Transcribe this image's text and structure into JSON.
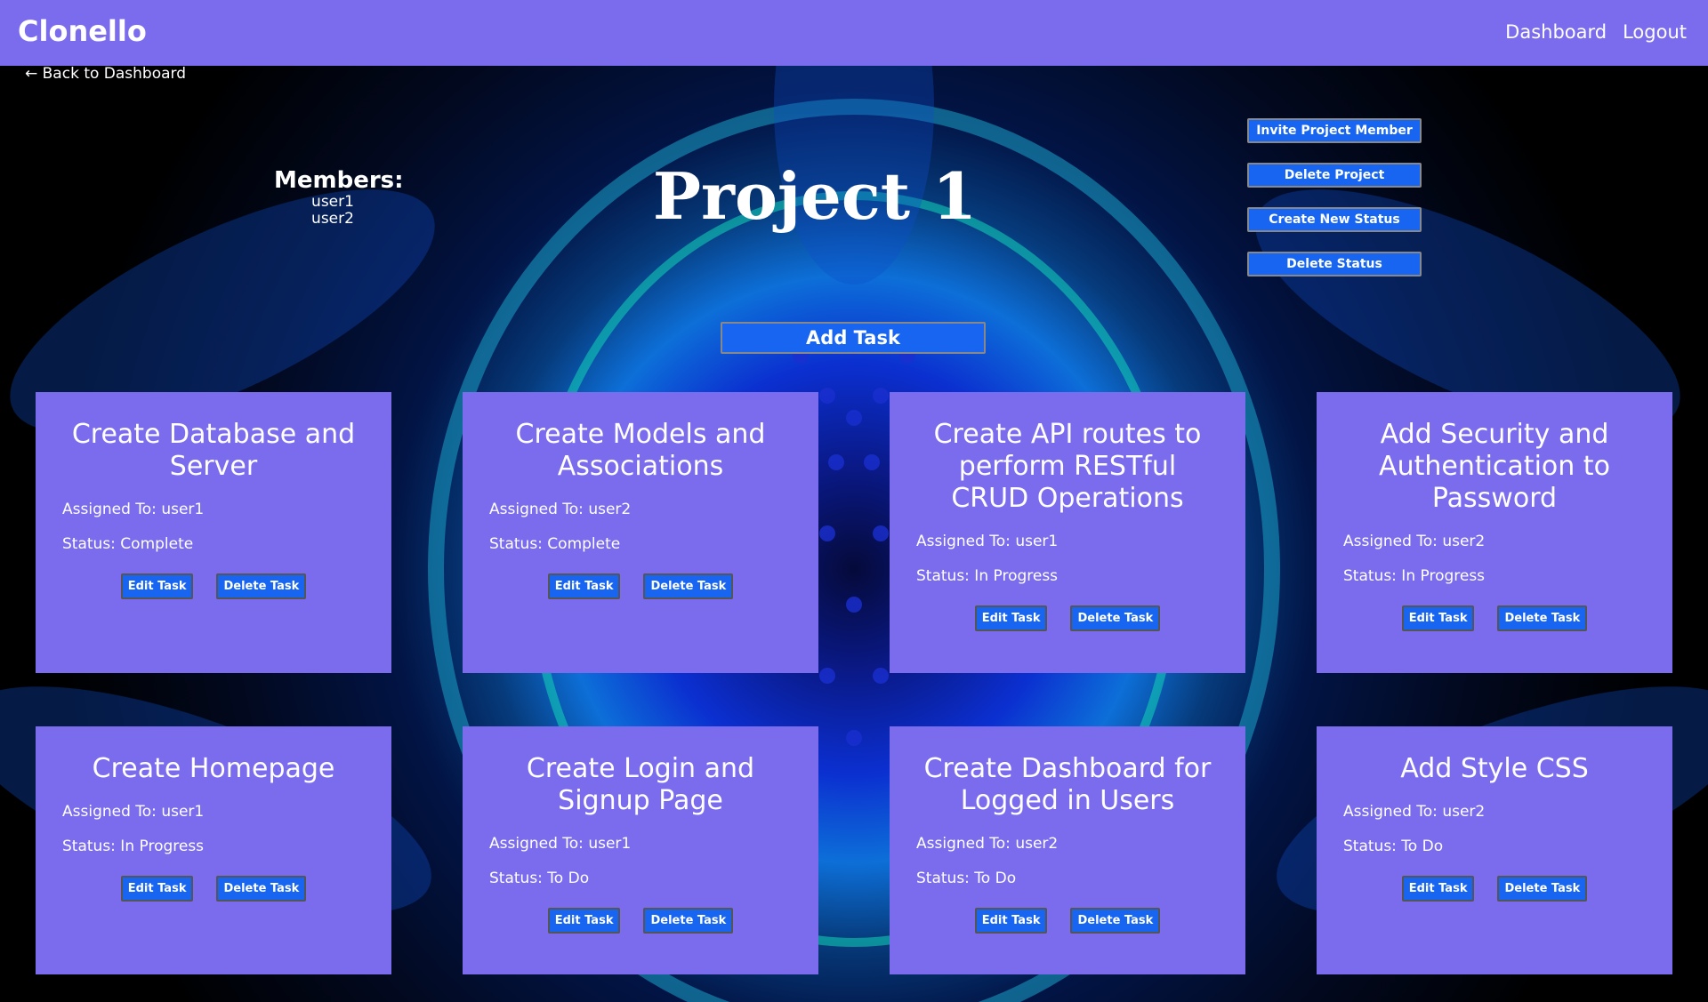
{
  "navbar": {
    "brand": "Clonello",
    "links": [
      "Dashboard",
      "Logout"
    ]
  },
  "back_link": "← Back to Dashboard",
  "members": {
    "title": "Members:",
    "names": [
      "user1",
      "user2"
    ]
  },
  "project": {
    "title": "Project 1"
  },
  "actions": [
    "Invite Project Member",
    "Delete Project",
    "Create New Status",
    "Delete Status"
  ],
  "add_task_label": "Add Task",
  "labels": {
    "assigned_prefix": "Assigned To: ",
    "status_prefix": "Status: ",
    "edit_label": "Edit Task",
    "delete_label": "Delete Task"
  },
  "tasks": [
    {
      "title": "Create Database and Server",
      "assigned": "Assigned To: user1",
      "status": "Status: Complete"
    },
    {
      "title": "Create Models and Associations",
      "assigned": "Assigned To: user2",
      "status": "Status: Complete"
    },
    {
      "title": "Create API routes to perform RESTful CRUD Operations",
      "assigned": "Assigned To: user1",
      "status": "Status: In Progress"
    },
    {
      "title": "Add Security and Authentication to Password",
      "assigned": "Assigned To: user2",
      "status": "Status: In Progress"
    },
    {
      "title": "Create Homepage",
      "assigned": "Assigned To: user1",
      "status": "Status: In Progress"
    },
    {
      "title": "Create Login and Signup Page",
      "assigned": "Assigned To: user1",
      "status": "Status: To Do"
    },
    {
      "title": "Create Dashboard for Logged in Users",
      "assigned": "Assigned To: user2",
      "status": "Status: To Do"
    },
    {
      "title": "Add Style CSS",
      "assigned": "Assigned To: user2",
      "status": "Status: To Do"
    }
  ],
  "colors": {
    "navbar": "#7b6cee",
    "card": "#7b6cee",
    "button": "#1865f2",
    "text": "#ffffff"
  }
}
